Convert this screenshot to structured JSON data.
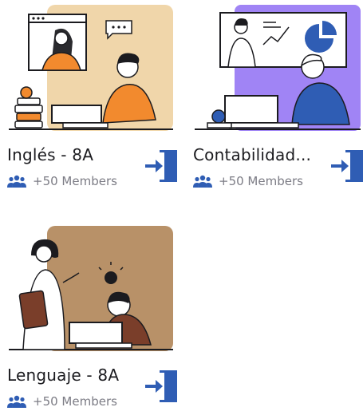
{
  "classes": [
    {
      "title": "Inglés - 8A",
      "members": "+50 Members",
      "icon": "door-enter-icon",
      "illustration": "online-class-illustration",
      "accent": "#f0d6aa"
    },
    {
      "title": "Contabilidad...",
      "members": "+50 Members",
      "icon": "door-enter-icon",
      "illustration": "video-conference-illustration",
      "accent": "#a084f5"
    },
    {
      "title": "Lenguaje - 8A",
      "members": "+50 Members",
      "icon": "door-enter-icon",
      "illustration": "teacher-student-illustration",
      "accent": "#b89168"
    }
  ],
  "colors": {
    "icon_blue": "#2f5db4",
    "text": "#1b1b1f",
    "muted": "#7c7c85"
  }
}
